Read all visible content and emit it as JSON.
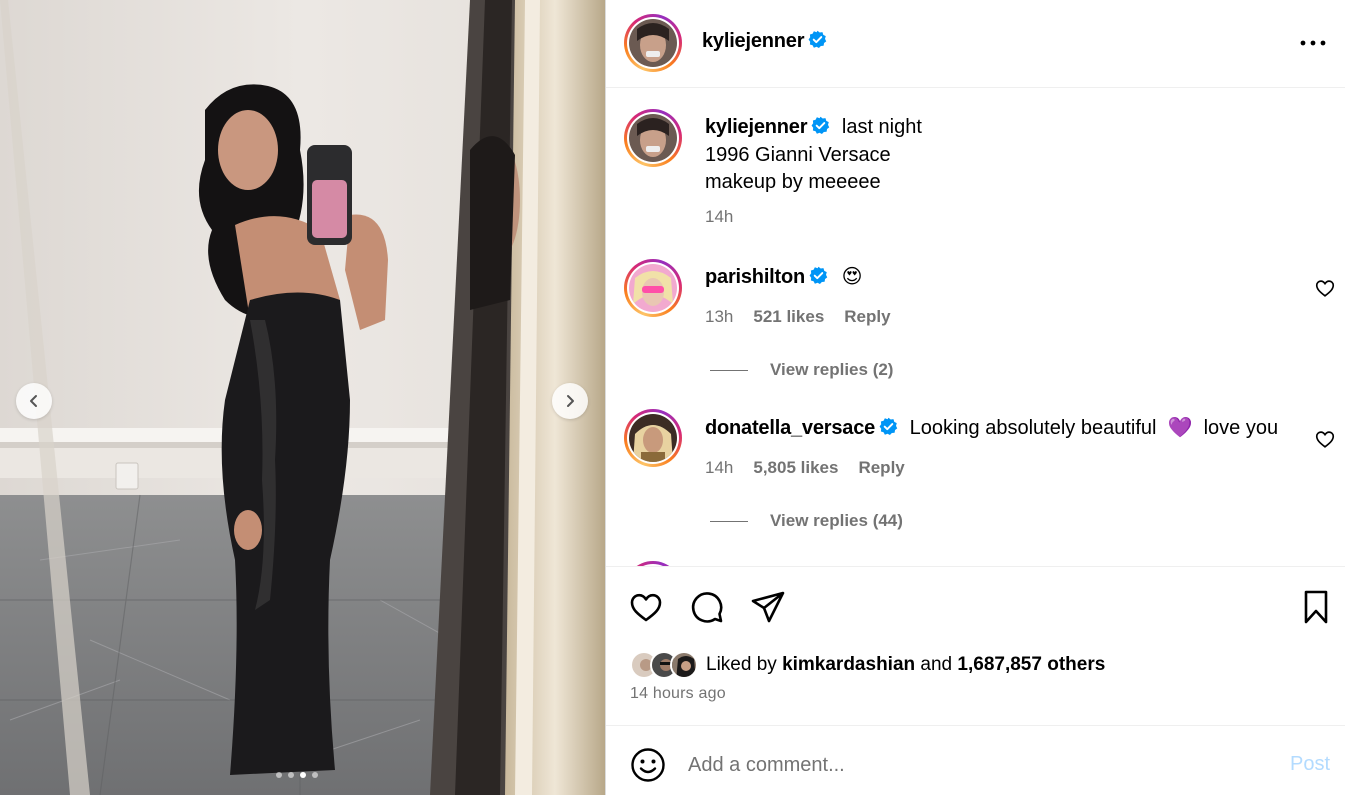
{
  "post": {
    "author": "kyliejenner",
    "caption_lines": [
      "last night",
      "1996 Gianni Versace",
      "makeup by meeeee"
    ],
    "caption_time": "14h",
    "carousel": {
      "slide_count": 4,
      "active_index": 2
    }
  },
  "comments": [
    {
      "username": "parishilton",
      "text": "😍",
      "time": "13h",
      "likes": "521 likes",
      "reply_label": "Reply",
      "view_replies": "View replies (2)"
    },
    {
      "username": "donatella_versace",
      "text": "Looking absolutely beautiful  💜  love you",
      "time": "14h",
      "likes": "5,805 likes",
      "reply_label": "Reply",
      "view_replies": "View replies (44)"
    }
  ],
  "engagement": {
    "liked_by_prefix": "Liked by",
    "liked_by_user": "kimkardashian",
    "and": "and",
    "others": "1,687,857 others",
    "timestamp": "14 hours ago"
  },
  "composer": {
    "placeholder": "Add a comment...",
    "post_label": "Post"
  },
  "icons": {
    "verified": "verified-badge-icon",
    "more": "more-options-icon",
    "like": "heart-icon",
    "comment": "comment-icon",
    "share": "share-icon",
    "save": "bookmark-icon",
    "emoji": "emoji-icon",
    "prev": "chevron-left-icon",
    "next": "chevron-right-icon"
  },
  "colors": {
    "verified_blue": "#0095f6",
    "muted_text": "#737373",
    "post_button_disabled": "#b3dbff",
    "story_ring_start": "#fdc468",
    "story_ring_end": "#d62976"
  }
}
